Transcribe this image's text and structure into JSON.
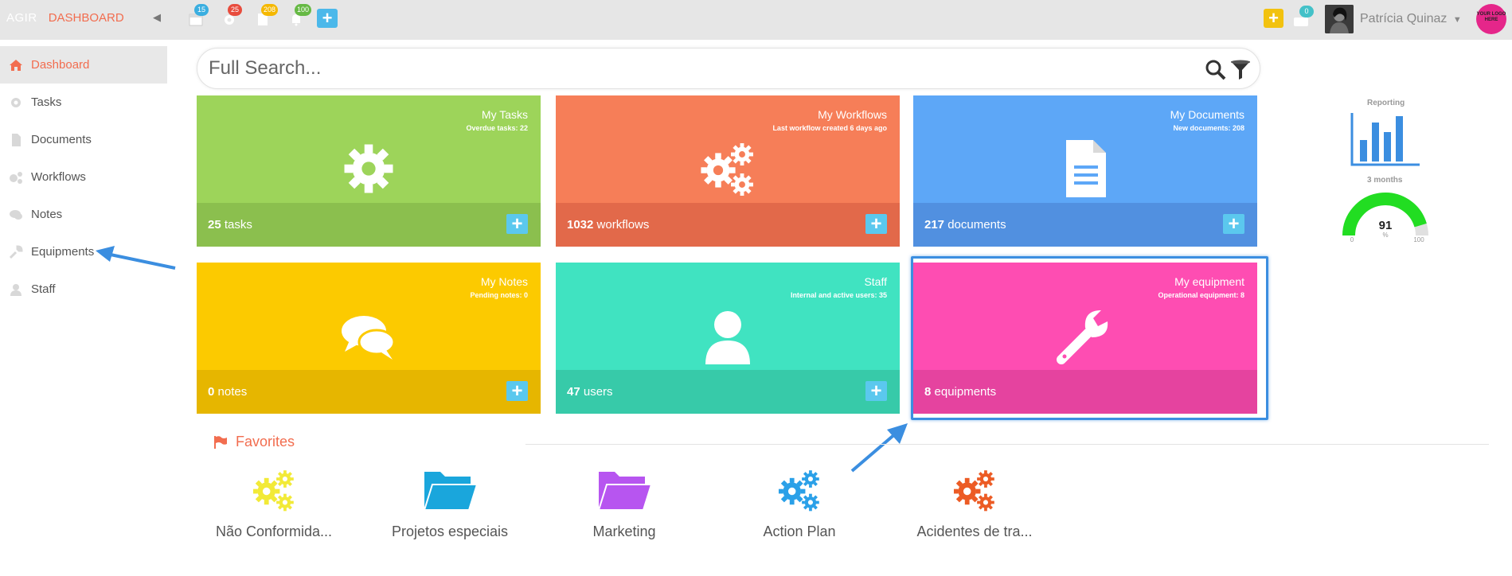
{
  "topbar": {
    "app_name": "AGIR",
    "section": "DASHBOARD",
    "badges": {
      "calendar": "15",
      "settings": "25",
      "documents": "208",
      "notifications": "100",
      "messages": "0"
    },
    "user_name": "Patrícia Quinaz",
    "logo_text": "YOUR LOGO HERE",
    "colors": {
      "calendar": "#3aaee0",
      "settings": "#e84c3d",
      "documents": "#f5b800",
      "notifications": "#66b944",
      "messages": "#43c1c8",
      "add_left": "#4bb8ea",
      "add_right": "#f2c20f"
    }
  },
  "sidebar": {
    "items": [
      {
        "label": "Dashboard",
        "icon": "home-icon"
      },
      {
        "label": "Tasks",
        "icon": "gear-icon"
      },
      {
        "label": "Documents",
        "icon": "document-icon"
      },
      {
        "label": "Workflows",
        "icon": "gears-icon"
      },
      {
        "label": "Notes",
        "icon": "chat-icon"
      },
      {
        "label": "Equipments",
        "icon": "wrench-icon"
      },
      {
        "label": "Staff",
        "icon": "user-icon"
      }
    ]
  },
  "search": {
    "placeholder": "Full Search..."
  },
  "tiles": [
    {
      "title": "My Tasks",
      "subtitle": "Overdue tasks: 22",
      "count": "25",
      "unit": "tasks",
      "color": "#9dd45a",
      "foot_color": "#8bbf4e",
      "icon": "gear-icon"
    },
    {
      "title": "My Workflows",
      "subtitle": "Last workflow created 6 days ago",
      "count": "1032",
      "unit": "workflows",
      "color": "#f67e58",
      "foot_color": "#e2694a",
      "icon": "gears-icon"
    },
    {
      "title": "My Documents",
      "subtitle": "New documents: 208",
      "count": "217",
      "unit": "documents",
      "color": "#5da7f7",
      "foot_color": "#5190e0",
      "icon": "document-icon"
    },
    {
      "title": "My Notes",
      "subtitle": "Pending notes: 0",
      "count": "0",
      "unit": "notes",
      "color": "#fcca00",
      "foot_color": "#e6b600",
      "icon": "chat-icon"
    },
    {
      "title": "Staff",
      "subtitle": "Internal and active users: 35",
      "count": "47",
      "unit": "users",
      "color": "#40e3c1",
      "foot_color": "#37caa9",
      "icon": "user-icon"
    },
    {
      "title": "My equipment",
      "subtitle": "Operational equipment: 8",
      "count": "8",
      "unit": "equipments",
      "color": "#fe4db2",
      "foot_color": "#e5439f",
      "icon": "wrench-icon"
    }
  ],
  "reporting": {
    "label": "Reporting",
    "period": "3 months",
    "gauge_value": "91",
    "gauge_unit": "%",
    "gauge_min": "0",
    "gauge_max": "100",
    "gauge_color": "#22dd22"
  },
  "favorites": {
    "title": "Favorites",
    "items": [
      {
        "label": "Não Conformida...",
        "icon": "gears-icon",
        "color": "#f2ea37"
      },
      {
        "label": "Projetos especiais",
        "icon": "folder-icon",
        "color": "#1aa6dc"
      },
      {
        "label": "Marketing",
        "icon": "folder-icon",
        "color": "#b755f0"
      },
      {
        "label": "Action Plan",
        "icon": "gears-icon",
        "color": "#2aa0e8"
      },
      {
        "label": "Acidentes de tra...",
        "icon": "gears-icon",
        "color": "#ec5b24"
      }
    ]
  }
}
